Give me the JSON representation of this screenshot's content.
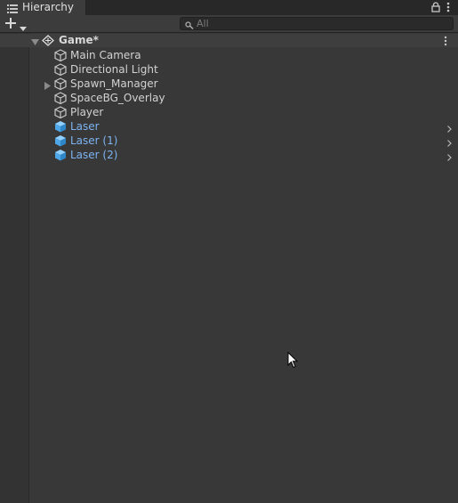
{
  "window": {
    "tab_title": "Hierarchy",
    "tab_icon": "list-icon",
    "actions": [
      "lock-icon",
      "kebab-menu-icon"
    ]
  },
  "toolbar": {
    "add_icon": "plus-icon",
    "add_dropdown_icon": "caret-down-icon",
    "search": {
      "placeholder": "All",
      "value": ""
    }
  },
  "scene": {
    "name": "Game*",
    "icon": "unity-scene-icon",
    "expanded": true
  },
  "objects": [
    {
      "label": "Main Camera",
      "icon": "gameobject-cube-icon",
      "prefab": false,
      "has_children": false
    },
    {
      "label": "Directional Light",
      "icon": "gameobject-cube-icon",
      "prefab": false,
      "has_children": false
    },
    {
      "label": "Spawn_Manager",
      "icon": "gameobject-cube-icon",
      "prefab": false,
      "has_children": true,
      "expanded": false
    },
    {
      "label": "SpaceBG_Overlay",
      "icon": "gameobject-cube-icon",
      "prefab": false,
      "has_children": false
    },
    {
      "label": "Player",
      "icon": "gameobject-cube-icon",
      "prefab": false,
      "has_children": false
    },
    {
      "label": "Laser",
      "icon": "prefab-cube-icon",
      "prefab": true,
      "has_children": false
    },
    {
      "label": "Laser (1)",
      "icon": "prefab-cube-icon",
      "prefab": true,
      "has_children": false
    },
    {
      "label": "Laser (2)",
      "icon": "prefab-cube-icon",
      "prefab": true,
      "has_children": false
    }
  ],
  "colors": {
    "background": "#383838",
    "text": "#d2d2d2",
    "prefab_text": "#7cb3f0",
    "prefab_icon": "#4ea6e6"
  }
}
